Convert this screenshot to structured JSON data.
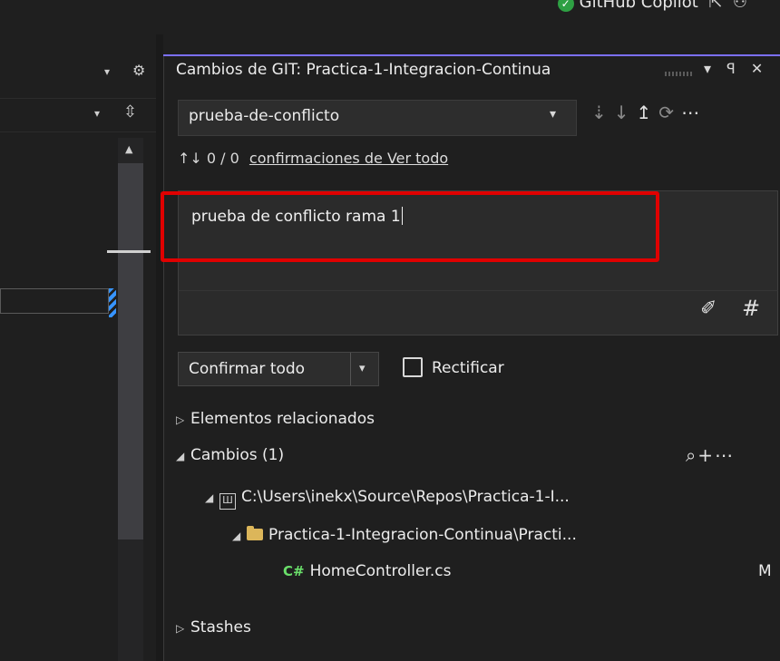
{
  "top": {
    "copilot_label": "GitHub Copilot",
    "copilot_check": "✓",
    "share_icon": "share-icon",
    "account_icon": "account-icon"
  },
  "left": {
    "header_dropdown": "▾",
    "header_gear": "⚙",
    "row2_dropdown": "▾",
    "row2_split": "⇳"
  },
  "git": {
    "title": "Cambios de GIT: Practica-1-Integracion-Continua",
    "title_actions": "▾ ꟼ ✕",
    "branch": "prueba-de-conflicto",
    "branch_dropdown": "▾",
    "sync_icons": {
      "fetch": "⇣",
      "pull": "↓",
      "push": "↥",
      "sync": "⟳",
      "more": "⋯"
    },
    "counts_icon": "↑↓",
    "counts": "0 / 0",
    "counts_link": "confirmaciones de Ver todo",
    "commit_message": "prueba de conflicto rama 1",
    "tools": {
      "ai": "✐",
      "hash": "#"
    },
    "commit_button": "Confirmar todo",
    "commit_dropdown": "▾",
    "amend_label": "Rectificar",
    "sections": {
      "related": "Elementos relacionados",
      "changes": "Cambios (1)",
      "stashes": "Stashes"
    },
    "changes_actions": "⌕+⋯",
    "repo_path": "C:\\Users\\inekx\\Source\\Repos\\Practica-1-I...",
    "repo_icon": "repo-icon",
    "project_path": "Practica-1-Integracion-Continua\\Practi...",
    "file_icon_text": "C#",
    "file_name": "HomeController.cs",
    "file_status": "M"
  },
  "colors": {
    "accent": "#7b70ff",
    "highlight_box": "#e00000",
    "folder": "#dcb65a",
    "csharp": "#6adf6a",
    "copilot": "#2ea043"
  }
}
